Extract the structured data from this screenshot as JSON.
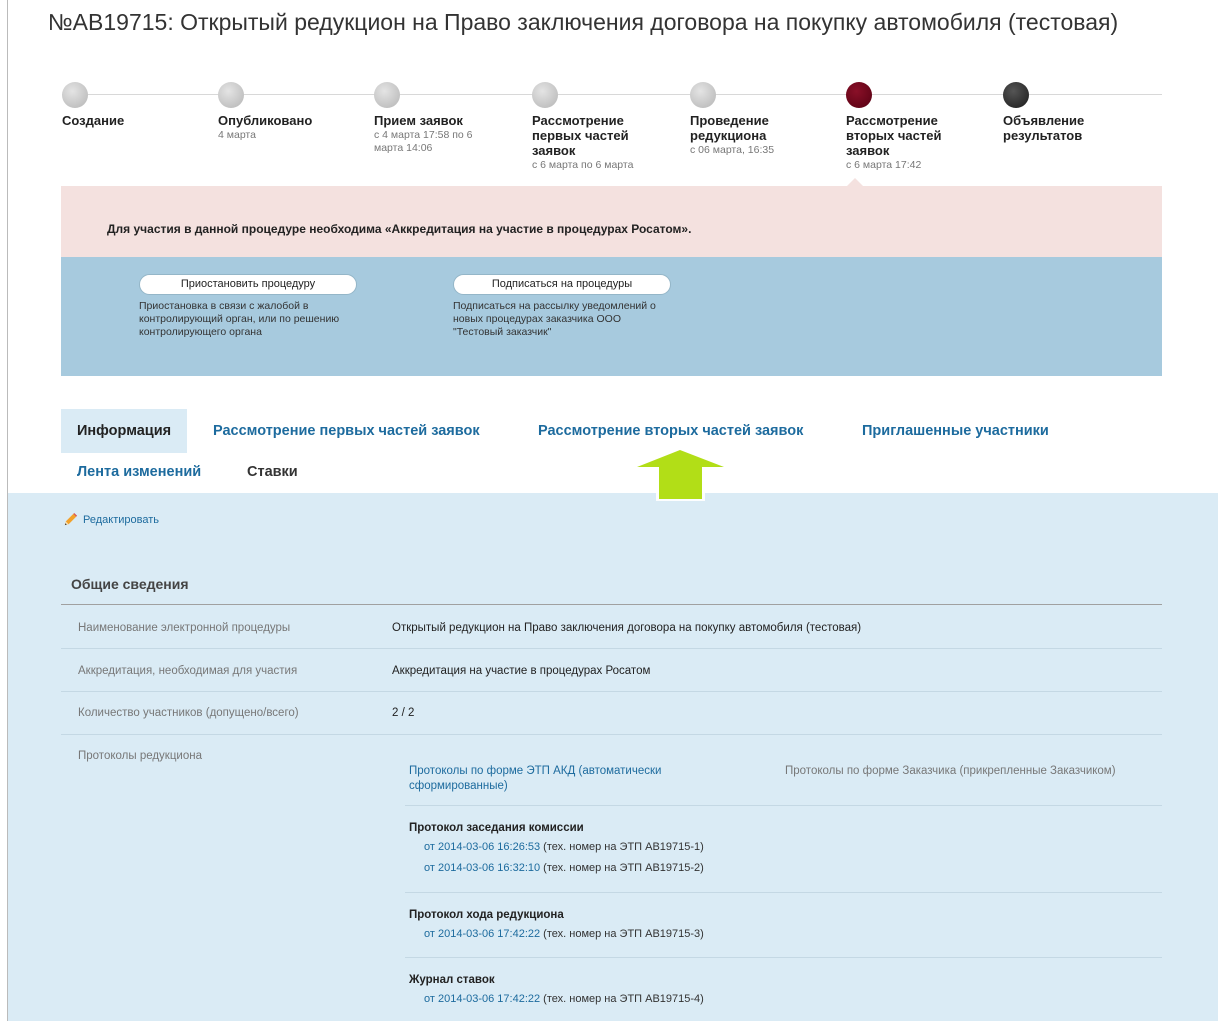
{
  "title": "№АВ19715: Открытый редукцион на Право заключения договора на покупку автомобиля (тестовая)",
  "steps": [
    {
      "title": "Создание",
      "date": "",
      "state": "done"
    },
    {
      "title": "Опубликовано",
      "date": "4 марта",
      "state": "done"
    },
    {
      "title": "Прием заявок",
      "date": "с 4 марта 17:58 по 6 марта 14:06",
      "state": "done"
    },
    {
      "title": "Рассмотрение первых частей заявок",
      "date": "с 6 марта по 6 марта",
      "state": "done"
    },
    {
      "title": "Проведение редукциона",
      "date": "с 06 марта, 16:35",
      "state": "done"
    },
    {
      "title": "Рассмотрение вторых частей заявок",
      "date": "с 6 марта 17:42",
      "state": "active"
    },
    {
      "title": "Объявление результатов",
      "date": "",
      "state": "final"
    }
  ],
  "alert": {
    "text": "Для участия в данной процедуре необходима «Аккредитация на участие в процедурах Росатом».",
    "color": "#f4e1df"
  },
  "actions": [
    {
      "label": "Приостановить процедуру",
      "desc": "Приостановка в связи с жалобой в контролирующий орган, или по решению контролирующего органа"
    },
    {
      "label": "Подписаться на процедуры",
      "desc": "Подписаться на рассылку уведомлений о новых процедурах заказчика ООО \"Тестовый заказчик\""
    }
  ],
  "tabs": [
    {
      "label": "Информация",
      "active": true
    },
    {
      "label": "Рассмотрение первых частей заявок"
    },
    {
      "label": "Рассмотрение вторых частей заявок"
    },
    {
      "label": "Приглашенные участники"
    },
    {
      "label": "Лента изменений"
    },
    {
      "label": "Ставки"
    }
  ],
  "edit_label": "Редактировать",
  "section_title": "Общие сведения",
  "info": [
    {
      "label": "Наименование электронной процедуры",
      "value": "Открытый редукцион на Право заключения договора на покупку автомобиля (тестовая)"
    },
    {
      "label": "Аккредитация, необходимая для участия",
      "value": "Аккредитация на участие в процедурах Росатом"
    },
    {
      "label": "Количество участников (допущено/всего)",
      "value": "2 / 2"
    },
    {
      "label": "Протоколы редукциона",
      "value": ""
    }
  ],
  "protocols": {
    "etp_link": "Протоколы по форме ЭТП АКД (автоматически сформированные)",
    "customer_label": "Протоколы по форме Заказчика (прикрепленные Заказчиком)",
    "groups": [
      {
        "title": "Протокол заседания комиссии",
        "entries": [
          {
            "link": "от 2014-03-06 16:26:53",
            "note": " (тех. номер на ЭТП АВ19715-1)"
          },
          {
            "link": "от 2014-03-06 16:32:10",
            "note": " (тех. номер на ЭТП АВ19715-2)"
          }
        ]
      },
      {
        "title": "Протокол хода редукциона",
        "entries": [
          {
            "link": "от 2014-03-06 17:42:22",
            "note": " (тех. номер на ЭТП АВ19715-3)"
          }
        ]
      },
      {
        "title": "Журнал ставок",
        "entries": [
          {
            "link": "от 2014-03-06 17:42:22",
            "note": " (тех. номер на ЭТП АВ19715-4)"
          }
        ]
      }
    ]
  },
  "colors": {
    "link": "#1d6b9e",
    "active_step": "#6b0a1e",
    "actions_panel": "#a7cade",
    "content_panel": "#daebf5",
    "arrow": "#b2de17"
  }
}
